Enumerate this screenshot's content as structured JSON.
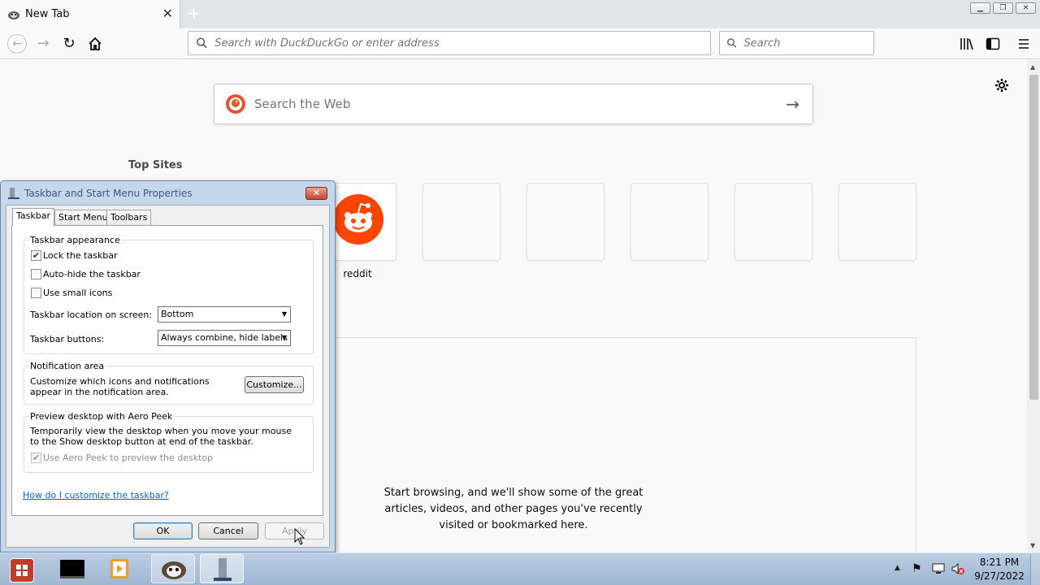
{
  "browser": {
    "tab_title": "New Tab",
    "url_placeholder": "Search with DuckDuckGo or enter address",
    "search_placeholder": "Search"
  },
  "newtab": {
    "web_search_placeholder": "Search the Web",
    "top_sites_title": "Top Sites",
    "tiles": [
      {
        "label": "reddit"
      },
      {
        "label": ""
      },
      {
        "label": ""
      },
      {
        "label": ""
      },
      {
        "label": ""
      },
      {
        "label": ""
      }
    ],
    "highlights_message": "Start browsing, and we'll show some of the great articles, videos, and other pages you've recently visited or bookmarked here."
  },
  "dialog": {
    "title": "Taskbar and Start Menu Properties",
    "tabs": [
      "Taskbar",
      "Start Menu",
      "Toolbars"
    ],
    "appearance": {
      "group_label": "Taskbar appearance",
      "lock_label": "Lock the taskbar",
      "lock_checked": true,
      "autohide_label": "Auto-hide the taskbar",
      "autohide_checked": false,
      "small_icons_label": "Use small icons",
      "small_icons_checked": false,
      "location_label": "Taskbar location on screen:",
      "location_value": "Bottom",
      "buttons_label": "Taskbar buttons:",
      "buttons_value": "Always combine, hide labels"
    },
    "notification": {
      "group_label": "Notification area",
      "text": "Customize which icons and notifications appear in the notification area.",
      "button": "Customize..."
    },
    "aero": {
      "group_label": "Preview desktop with Aero Peek",
      "text": "Temporarily view the desktop when you move your mouse to the Show desktop button at end of the taskbar.",
      "checkbox_label": "Use Aero Peek to preview the desktop",
      "checked": true,
      "disabled": true
    },
    "help_link": "How do I customize the taskbar?",
    "ok": "OK",
    "cancel": "Cancel",
    "apply": "Apply"
  },
  "taskbar": {
    "time": "8:21 PM",
    "date": "9/27/2022"
  },
  "colors": {
    "reddit": "#ff4500",
    "link": "#0066cc",
    "taskbar": "#a9bfd8"
  }
}
